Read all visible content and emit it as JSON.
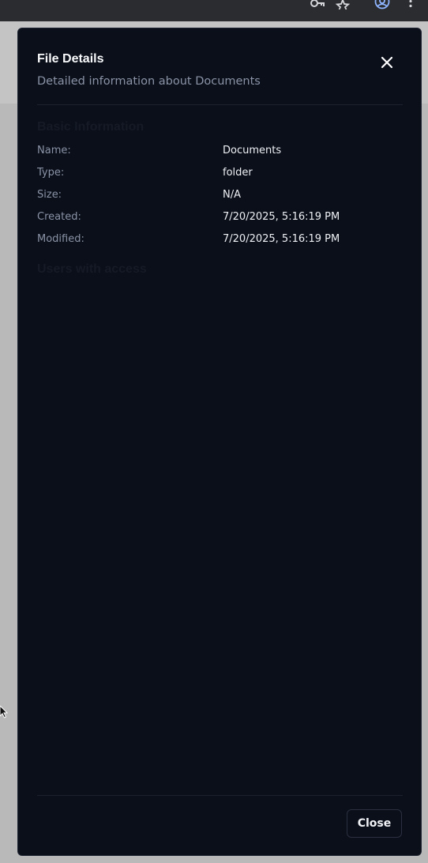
{
  "browser": {
    "icons": [
      "key-icon",
      "star-icon",
      "profile-icon",
      "more-vert-icon"
    ]
  },
  "dialog": {
    "title": "File Details",
    "subtitle": "Detailed information about Documents",
    "basic_info": {
      "heading": "Basic Information",
      "rows": [
        {
          "label": "Name:",
          "value": "Documents"
        },
        {
          "label": "Type:",
          "value": "folder"
        },
        {
          "label": "Size:",
          "value": "N/A"
        },
        {
          "label": "Created:",
          "value": "7/20/2025, 5:16:19 PM"
        },
        {
          "label": "Modified:",
          "value": "7/20/2025, 5:16:19 PM"
        }
      ]
    },
    "access": {
      "heading": "Users with access"
    },
    "footer": {
      "close_label": "Close"
    }
  }
}
